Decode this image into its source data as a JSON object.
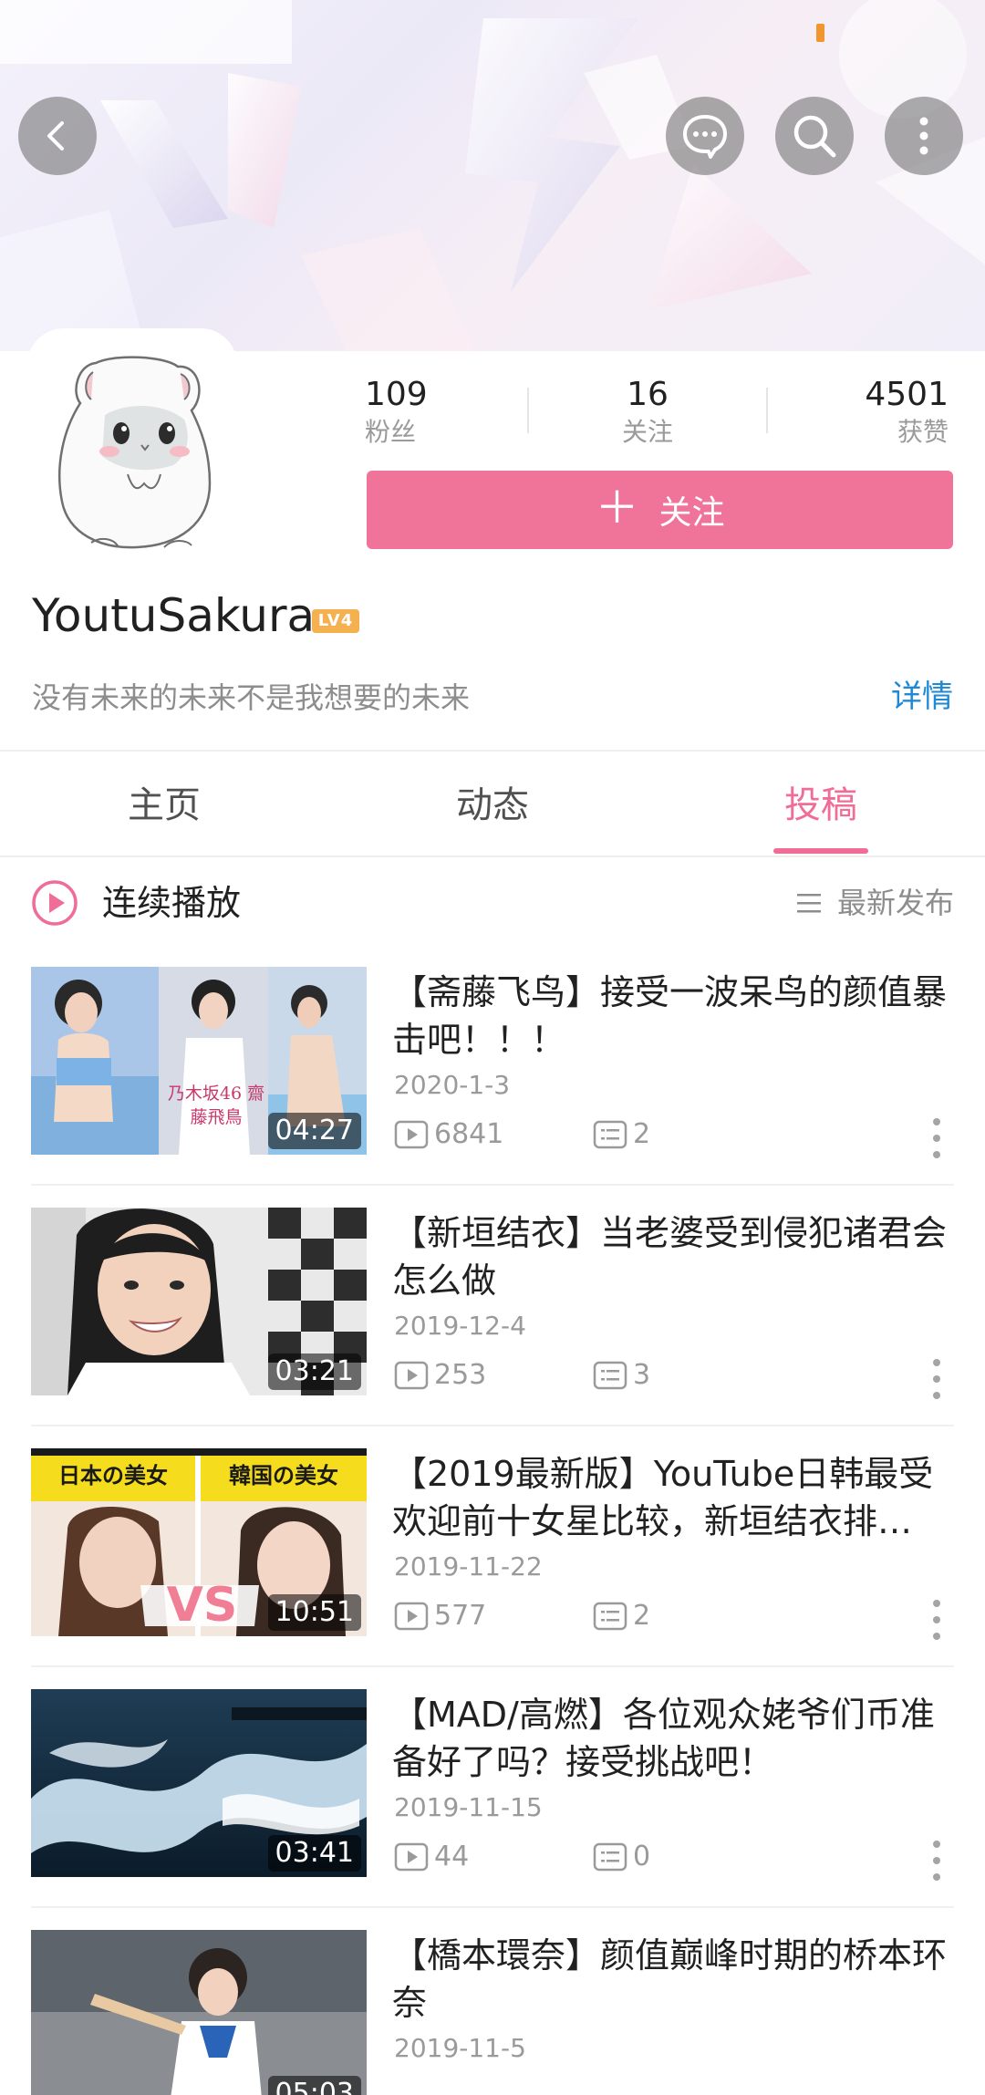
{
  "header": {
    "back_icon": "back-arrow-icon",
    "chat_icon": "chat-bubble-icon",
    "search_icon": "search-icon",
    "more_icon": "more-vertical-icon"
  },
  "profile": {
    "stats": {
      "fans": {
        "value": "109",
        "label": "粉丝"
      },
      "following": {
        "value": "16",
        "label": "关注"
      },
      "likes": {
        "value": "4501",
        "label": "获赞"
      }
    },
    "follow_button": "关注",
    "username": "YoutuSakura",
    "level": "LV4",
    "bio": "没有未来的未来不是我想要的未来",
    "detail_link": "详情"
  },
  "tabs": {
    "home": "主页",
    "dynamic": "动态",
    "posts": "投稿",
    "active": "投稿"
  },
  "playbar": {
    "label": "连续播放",
    "sort_label": "最新发布"
  },
  "colors": {
    "accent_pink": "#ef6d97",
    "follow_button": "#f07399",
    "link_blue": "#1e8ad6",
    "level_badge": "#f5b04f"
  },
  "videos": [
    {
      "title": "【斋藤飞鸟】接受一波呆鸟的颜值暴击吧！！！",
      "date": "2020-1-3",
      "views": "6841",
      "comments": "2",
      "duration": "04:27"
    },
    {
      "title": "【新垣结衣】当老婆受到侵犯诸君会怎么做",
      "date": "2019-12-4",
      "views": "253",
      "comments": "3",
      "duration": "03:21"
    },
    {
      "title": "【2019最新版】YouTube日韩最受欢迎前十女星比较，新垣结衣排…",
      "date": "2019-11-22",
      "views": "577",
      "comments": "2",
      "duration": "10:51"
    },
    {
      "title": "【MAD/高燃】各位观众姥爷们币准备好了吗？接受挑战吧！",
      "date": "2019-11-15",
      "views": "44",
      "comments": "0",
      "duration": "03:41"
    },
    {
      "title": "【橋本環奈】颜值巅峰时期的桥本环奈",
      "date": "2019-11-5",
      "views": "",
      "comments": "",
      "duration": "05:03"
    }
  ],
  "thumb_texts": {
    "v0_overlay": "乃木坂46 齋藤飛鳥",
    "v2_left": "日本の美女",
    "v2_right": "韓国の美女",
    "v2_vs": "VS"
  }
}
